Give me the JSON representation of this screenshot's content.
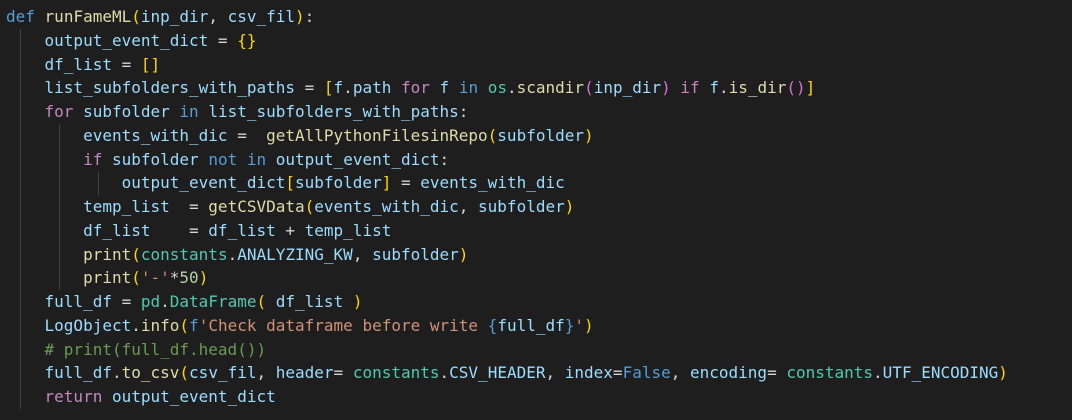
{
  "editor": {
    "lines": [
      {
        "indent": 0,
        "segments": [
          {
            "c": "kw",
            "t": "def"
          },
          {
            "c": "op",
            "t": " "
          },
          {
            "c": "fn",
            "t": "runFameML"
          },
          {
            "c": "br1",
            "t": "("
          },
          {
            "c": "var",
            "t": "inp_dir"
          },
          {
            "c": "op",
            "t": ", "
          },
          {
            "c": "var",
            "t": "csv_fil"
          },
          {
            "c": "br1",
            "t": ")"
          },
          {
            "c": "op",
            "t": ":"
          }
        ]
      },
      {
        "indent": 1,
        "segments": [
          {
            "c": "var",
            "t": "output_event_dict"
          },
          {
            "c": "op",
            "t": " = "
          },
          {
            "c": "br1",
            "t": "{}"
          }
        ]
      },
      {
        "indent": 1,
        "segments": [
          {
            "c": "var",
            "t": "df_list"
          },
          {
            "c": "op",
            "t": " = "
          },
          {
            "c": "br1",
            "t": "[]"
          }
        ]
      },
      {
        "indent": 1,
        "segments": [
          {
            "c": "var",
            "t": "list_subfolders_with_paths"
          },
          {
            "c": "op",
            "t": " = "
          },
          {
            "c": "br1",
            "t": "["
          },
          {
            "c": "var",
            "t": "f"
          },
          {
            "c": "op",
            "t": "."
          },
          {
            "c": "var",
            "t": "path"
          },
          {
            "c": "op",
            "t": " "
          },
          {
            "c": "ctrl",
            "t": "for"
          },
          {
            "c": "op",
            "t": " "
          },
          {
            "c": "var",
            "t": "f"
          },
          {
            "c": "op",
            "t": " "
          },
          {
            "c": "kw",
            "t": "in"
          },
          {
            "c": "op",
            "t": " "
          },
          {
            "c": "cls",
            "t": "os"
          },
          {
            "c": "op",
            "t": "."
          },
          {
            "c": "fn",
            "t": "scandir"
          },
          {
            "c": "br2",
            "t": "("
          },
          {
            "c": "var",
            "t": "inp_dir"
          },
          {
            "c": "br2",
            "t": ")"
          },
          {
            "c": "op",
            "t": " "
          },
          {
            "c": "ctrl",
            "t": "if"
          },
          {
            "c": "op",
            "t": " "
          },
          {
            "c": "var",
            "t": "f"
          },
          {
            "c": "op",
            "t": "."
          },
          {
            "c": "fn",
            "t": "is_dir"
          },
          {
            "c": "br2",
            "t": "()"
          },
          {
            "c": "br1",
            "t": "]"
          }
        ]
      },
      {
        "indent": 1,
        "segments": [
          {
            "c": "ctrl",
            "t": "for"
          },
          {
            "c": "op",
            "t": " "
          },
          {
            "c": "var",
            "t": "subfolder"
          },
          {
            "c": "op",
            "t": " "
          },
          {
            "c": "kw",
            "t": "in"
          },
          {
            "c": "op",
            "t": " "
          },
          {
            "c": "var",
            "t": "list_subfolders_with_paths"
          },
          {
            "c": "op",
            "t": ":"
          }
        ]
      },
      {
        "indent": 2,
        "segments": [
          {
            "c": "var",
            "t": "events_with_dic"
          },
          {
            "c": "op",
            "t": " =  "
          },
          {
            "c": "fn",
            "t": "getAllPythonFilesinRepo"
          },
          {
            "c": "br1",
            "t": "("
          },
          {
            "c": "var",
            "t": "subfolder"
          },
          {
            "c": "br1",
            "t": ")"
          }
        ]
      },
      {
        "indent": 2,
        "segments": [
          {
            "c": "ctrl",
            "t": "if"
          },
          {
            "c": "op",
            "t": " "
          },
          {
            "c": "var",
            "t": "subfolder"
          },
          {
            "c": "op",
            "t": " "
          },
          {
            "c": "kw",
            "t": "not"
          },
          {
            "c": "op",
            "t": " "
          },
          {
            "c": "kw",
            "t": "in"
          },
          {
            "c": "op",
            "t": " "
          },
          {
            "c": "var",
            "t": "output_event_dict"
          },
          {
            "c": "op",
            "t": ":"
          }
        ]
      },
      {
        "indent": 3,
        "segments": [
          {
            "c": "var",
            "t": "output_event_dict"
          },
          {
            "c": "br1",
            "t": "["
          },
          {
            "c": "var",
            "t": "subfolder"
          },
          {
            "c": "br1",
            "t": "]"
          },
          {
            "c": "op",
            "t": " = "
          },
          {
            "c": "var",
            "t": "events_with_dic"
          }
        ]
      },
      {
        "indent": 2,
        "segments": [
          {
            "c": "var",
            "t": "temp_list"
          },
          {
            "c": "op",
            "t": "  = "
          },
          {
            "c": "fn",
            "t": "getCSVData"
          },
          {
            "c": "br1",
            "t": "("
          },
          {
            "c": "var",
            "t": "events_with_dic"
          },
          {
            "c": "op",
            "t": ", "
          },
          {
            "c": "var",
            "t": "subfolder"
          },
          {
            "c": "br1",
            "t": ")"
          }
        ]
      },
      {
        "indent": 2,
        "segments": [
          {
            "c": "var",
            "t": "df_list"
          },
          {
            "c": "op",
            "t": "    = "
          },
          {
            "c": "var",
            "t": "df_list"
          },
          {
            "c": "op",
            "t": " + "
          },
          {
            "c": "var",
            "t": "temp_list"
          }
        ]
      },
      {
        "indent": 2,
        "segments": [
          {
            "c": "fn",
            "t": "print"
          },
          {
            "c": "br1",
            "t": "("
          },
          {
            "c": "cls",
            "t": "constants"
          },
          {
            "c": "op",
            "t": "."
          },
          {
            "c": "var",
            "t": "ANALYZING_KW"
          },
          {
            "c": "op",
            "t": ", "
          },
          {
            "c": "var",
            "t": "subfolder"
          },
          {
            "c": "br1",
            "t": ")"
          }
        ]
      },
      {
        "indent": 2,
        "segments": [
          {
            "c": "fn",
            "t": "print"
          },
          {
            "c": "br1",
            "t": "("
          },
          {
            "c": "str",
            "t": "'-'"
          },
          {
            "c": "op",
            "t": "*"
          },
          {
            "c": "num",
            "t": "50"
          },
          {
            "c": "br1",
            "t": ")"
          }
        ]
      },
      {
        "indent": 1,
        "segments": [
          {
            "c": "var",
            "t": "full_df"
          },
          {
            "c": "op",
            "t": " = "
          },
          {
            "c": "cls",
            "t": "pd"
          },
          {
            "c": "op",
            "t": "."
          },
          {
            "c": "cls",
            "t": "DataFrame"
          },
          {
            "c": "br1",
            "t": "("
          },
          {
            "c": "op",
            "t": " "
          },
          {
            "c": "var",
            "t": "df_list"
          },
          {
            "c": "op",
            "t": " "
          },
          {
            "c": "br1",
            "t": ")"
          }
        ]
      },
      {
        "indent": 1,
        "segments": [
          {
            "c": "var",
            "t": "LogObject"
          },
          {
            "c": "op",
            "t": "."
          },
          {
            "c": "fn",
            "t": "info"
          },
          {
            "c": "br1",
            "t": "("
          },
          {
            "c": "kw",
            "t": "f"
          },
          {
            "c": "str",
            "t": "'Check dataframe before write "
          },
          {
            "c": "kw",
            "t": "{"
          },
          {
            "c": "var",
            "t": "full_df"
          },
          {
            "c": "kw",
            "t": "}"
          },
          {
            "c": "str",
            "t": "'"
          },
          {
            "c": "br1",
            "t": ")"
          }
        ]
      },
      {
        "indent": 1,
        "segments": [
          {
            "c": "cmt",
            "t": "# print(full_df.head())"
          }
        ]
      },
      {
        "indent": 1,
        "segments": [
          {
            "c": "var",
            "t": "full_df"
          },
          {
            "c": "op",
            "t": "."
          },
          {
            "c": "fn",
            "t": "to_csv"
          },
          {
            "c": "br1",
            "t": "("
          },
          {
            "c": "var",
            "t": "csv_fil"
          },
          {
            "c": "op",
            "t": ", "
          },
          {
            "c": "var",
            "t": "header"
          },
          {
            "c": "op",
            "t": "= "
          },
          {
            "c": "cls",
            "t": "constants"
          },
          {
            "c": "op",
            "t": "."
          },
          {
            "c": "var",
            "t": "CSV_HEADER"
          },
          {
            "c": "op",
            "t": ", "
          },
          {
            "c": "var",
            "t": "index"
          },
          {
            "c": "op",
            "t": "="
          },
          {
            "c": "kw",
            "t": "False"
          },
          {
            "c": "op",
            "t": ", "
          },
          {
            "c": "var",
            "t": "encoding"
          },
          {
            "c": "op",
            "t": "= "
          },
          {
            "c": "cls",
            "t": "constants"
          },
          {
            "c": "op",
            "t": "."
          },
          {
            "c": "var",
            "t": "UTF_ENCODING"
          },
          {
            "c": "br1",
            "t": ")"
          }
        ]
      },
      {
        "indent": 1,
        "segments": [
          {
            "c": "ctrl",
            "t": "return"
          },
          {
            "c": "op",
            "t": " "
          },
          {
            "c": "var",
            "t": "output_event_dict"
          }
        ]
      }
    ]
  }
}
